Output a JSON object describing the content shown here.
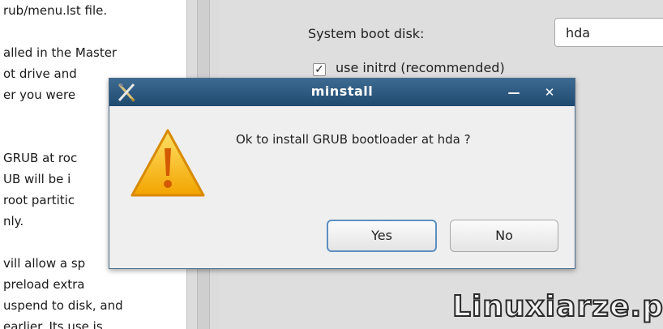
{
  "help_text": {
    "lines": [
      "rub/menu.lst file.",
      "alled in the Master",
      "ot drive and",
      "er you were",
      "GRUB at roc",
      "UB will be i",
      "root partitic",
      "nly.",
      "vill allow a sp",
      "preload extra",
      "uspend to disk, and",
      "earlier. Its use is"
    ]
  },
  "config": {
    "boot_disk_label": "System boot disk:",
    "boot_disk_value": "hda",
    "initrd_checked": "✓",
    "initrd_label": "use initrd (recommended)"
  },
  "dialog": {
    "title": "minstall",
    "minimize_glyph": "—",
    "close_glyph": "✕",
    "message": "Ok to install GRUB bootloader at hda ?",
    "yes_label": "Yes",
    "no_label": "No",
    "icon": "warning-icon"
  },
  "watermark": "Linuxiarze.pl",
  "colors": {
    "titlebar": "#1f4a70",
    "warning": "#f5b400",
    "default_button_border": "#5c8fc0"
  }
}
